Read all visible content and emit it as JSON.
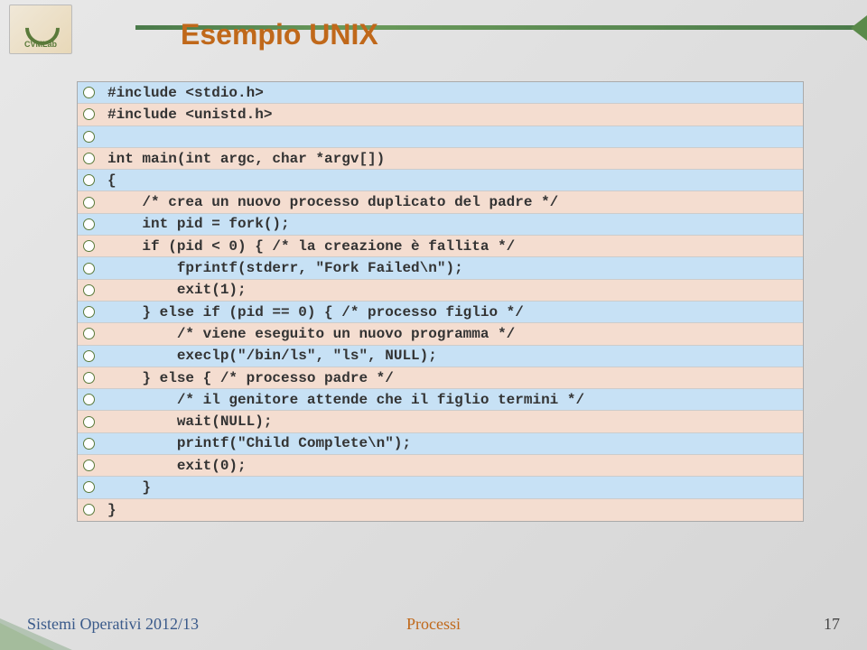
{
  "logo_label": "CVMLab",
  "title": "Esempio UNIX",
  "code_lines": [
    "#include <stdio.h>",
    "#include <unistd.h>",
    "",
    "int main(int argc, char *argv[])",
    "{",
    "    /* crea un nuovo processo duplicato del padre */",
    "    int pid = fork();",
    "    if (pid < 0) { /* la creazione è fallita */",
    "        fprintf(stderr, \"Fork Failed\\n\");",
    "        exit(1);",
    "    } else if (pid == 0) { /* processo figlio */",
    "        /* viene eseguito un nuovo programma */",
    "        execlp(\"/bin/ls\", \"ls\", NULL);",
    "    } else { /* processo padre */",
    "        /* il genitore attende che il figlio termini */",
    "        wait(NULL);",
    "        printf(\"Child Complete\\n\");",
    "        exit(0);",
    "    }",
    "}"
  ],
  "footer": {
    "left": "Sistemi Operativi 2012/13",
    "mid": "Processi",
    "right": "17"
  }
}
